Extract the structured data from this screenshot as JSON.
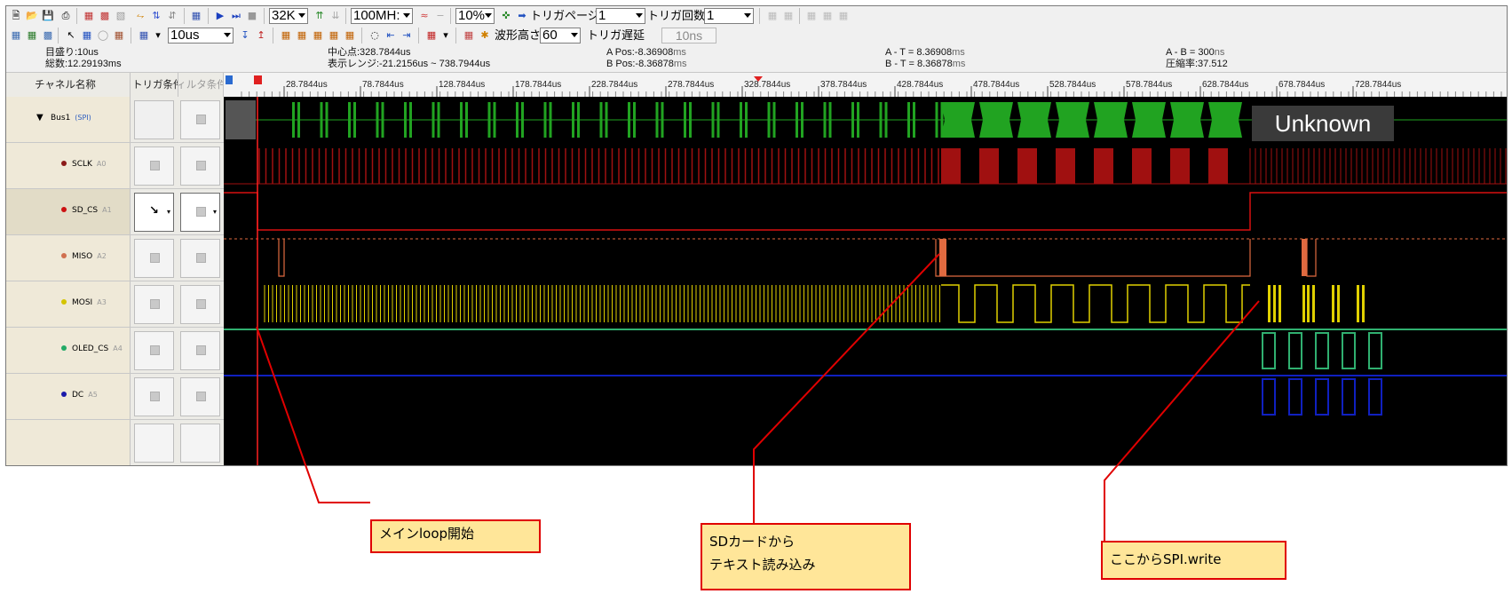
{
  "toolbar1": {
    "sample_depth": "32K",
    "sample_rate": "100MH:",
    "trigger_position": "10%",
    "trigger_page_label": "トリガページ",
    "trigger_page_value": "1",
    "trigger_count_label": "トリガ回数",
    "trigger_count_value": "1"
  },
  "toolbar2": {
    "time_div": "10us",
    "waveform_height_label": "波形高さ",
    "waveform_height_value": "60",
    "trigger_delay_label": "トリガ遅延",
    "trigger_delay_value": "10ns"
  },
  "info": {
    "division": "目盛り:10us",
    "total": "総数:12.29193ms",
    "center": "中心点:328.7844us",
    "display_range": "表示レンジ:-21.2156us ~ 738.7944us",
    "a_pos": "A Pos:-8.36908",
    "b_pos": "B Pos:-8.36878",
    "a_minus_t": "A - T = 8.36908",
    "b_minus_t": "B - T = 8.36878",
    "a_minus_b": "A - B = 300",
    "compression": "圧縮率:37.512",
    "unit_glyph": "ms",
    "ns_glyph": "ns"
  },
  "headers": {
    "channel_name": "チャネル名称",
    "trigger_condition": "トリガ条件",
    "filter_condition": "フィルタ条件"
  },
  "channels": [
    {
      "name": "Bus1",
      "src": "(SPI)",
      "color": "#000000"
    },
    {
      "name": "SCLK",
      "src": "A0",
      "color": "#8b1a1a"
    },
    {
      "name": "SD_CS",
      "src": "A1",
      "color": "#cc1111"
    },
    {
      "name": "MISO",
      "src": "A2",
      "color": "#d07050"
    },
    {
      "name": "MOSI",
      "src": "A3",
      "color": "#d4c400"
    },
    {
      "name": "OLED_CS",
      "src": "A4",
      "color": "#22aa66"
    },
    {
      "name": "DC",
      "src": "A5",
      "color": "#1a1aaa"
    }
  ],
  "ruler_labels": [
    "28.7844us",
    "78.7844us",
    "128.7844us",
    "178.7844us",
    "228.7844us",
    "278.7844us",
    "328.7844us",
    "378.7844us",
    "428.7844us",
    "478.7844us",
    "528.7844us",
    "578.7844us",
    "628.7844us",
    "678.7844us",
    "728.7844us"
  ],
  "bus_decode": "Unknown",
  "callouts": {
    "loop_start": "メインloop開始",
    "sd_read_line1": "SDカードから",
    "sd_read_line2": "テキスト読み込み",
    "spi_write": "ここからSPI.write"
  },
  "colors": {
    "sclk": "#a01010",
    "sd_cs": "#d81010",
    "miso": "#e06a40",
    "mosi": "#e0d000",
    "oled_cs": "#30b070",
    "dc": "#1020c0",
    "bus": "#21a321",
    "cursor": "#ff2020",
    "callout_bg": "#ffe699",
    "callout_border": "#e00000"
  }
}
